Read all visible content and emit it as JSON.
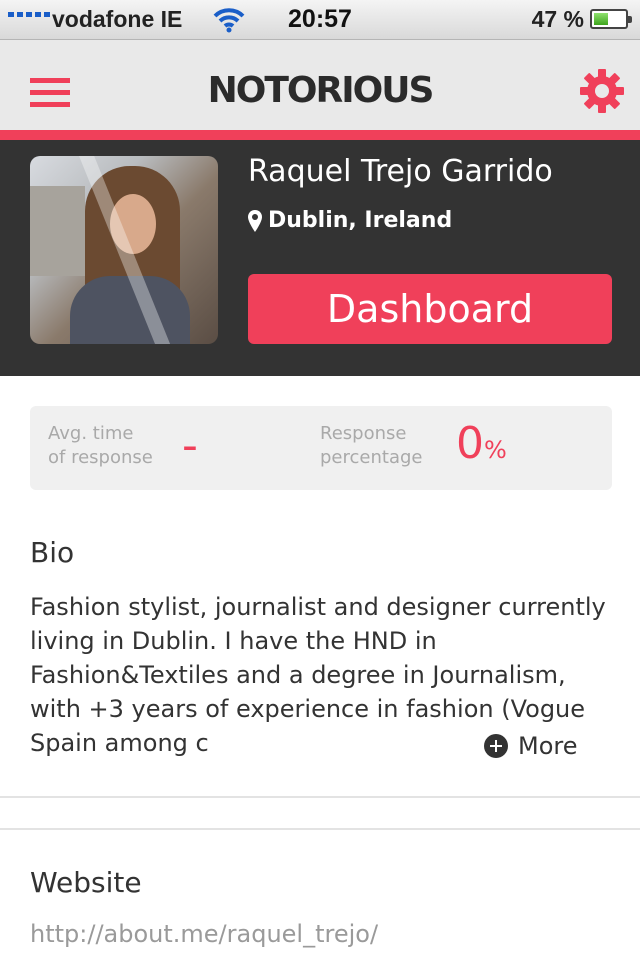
{
  "status_bar": {
    "carrier": "vodafone IE",
    "time": "20:57",
    "battery": "47 %",
    "battery_level": 0.47
  },
  "nav": {
    "title": "NOTORIOUS",
    "menu_icon": "hamburger-icon",
    "settings_icon": "gear-icon"
  },
  "profile": {
    "name": "Raquel Trejo Garrido",
    "location": "Dublin, Ireland",
    "dashboard_label": "Dashboard"
  },
  "stats": {
    "avg_label_1": "Avg. time",
    "avg_label_2": "of response",
    "avg_value": "-",
    "pct_label_1": "Response",
    "pct_label_2": "percentage",
    "pct_value": "0",
    "pct_unit": "%"
  },
  "bio": {
    "title": "Bio",
    "text": "Fashion stylist, journalist and designer currently living in Dublin. I have the HND in Fashion&Textiles and a degree in Journalism, with +3 years of experience in fashion (Vogue Spain among c",
    "more_label": "More"
  },
  "website": {
    "title": "Website",
    "url": "http://about.me/raquel_trejo/"
  },
  "colors": {
    "accent": "#f0405a",
    "header_dark": "#333333",
    "nav_bg": "#e9e9e9"
  }
}
